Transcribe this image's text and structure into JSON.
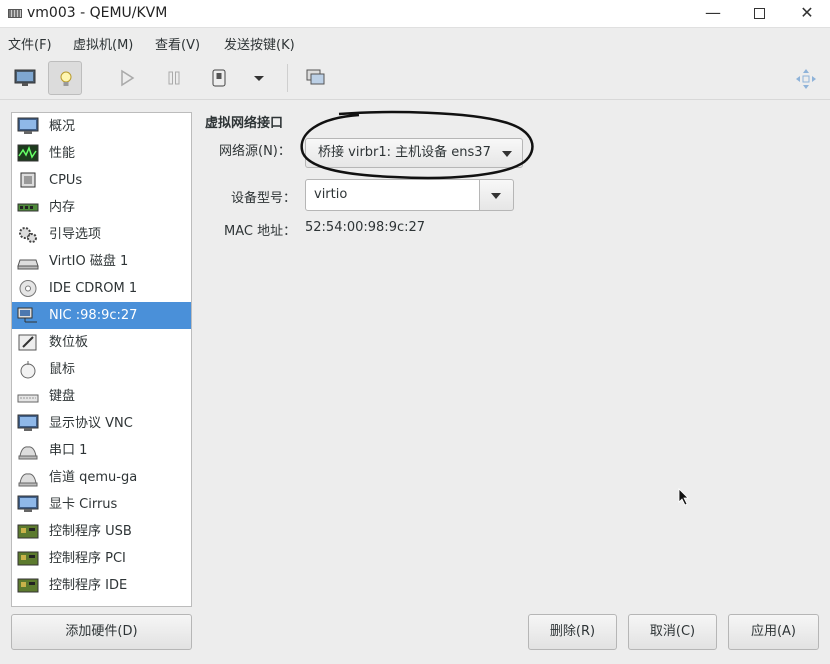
{
  "window": {
    "title": "vm003 - QEMU/KVM"
  },
  "menubar": {
    "items": [
      "文件(F)",
      "虚拟机(M)",
      "查看(V)",
      "发送按键(K)"
    ]
  },
  "toolbar": {
    "buttons": [
      {
        "icon": "monitor-icon",
        "active": false
      },
      {
        "icon": "lightbulb-icon",
        "active": true
      },
      {
        "icon": "play-icon",
        "active": false
      },
      {
        "icon": "pause-icon",
        "active": false
      },
      {
        "icon": "power-icon",
        "active": false
      },
      {
        "icon": "chevron-down-icon",
        "active": false
      },
      {
        "icon": "snapshots-icon",
        "active": false
      },
      {
        "icon": "fullscreen-icon",
        "active": false
      }
    ]
  },
  "sidebar": {
    "items": [
      {
        "label": "概况",
        "icon": "overview-monitor-icon"
      },
      {
        "label": "性能",
        "icon": "performance-icon"
      },
      {
        "label": "CPUs",
        "icon": "cpu-icon"
      },
      {
        "label": "内存",
        "icon": "memory-icon"
      },
      {
        "label": "引导选项",
        "icon": "boot-gear-icon"
      },
      {
        "label": "VirtIO 磁盘 1",
        "icon": "disk-icon"
      },
      {
        "label": "IDE CDROM 1",
        "icon": "cdrom-icon"
      },
      {
        "label": "NIC :98:9c:27",
        "icon": "nic-icon",
        "selected": true
      },
      {
        "label": "数位板",
        "icon": "tablet-icon"
      },
      {
        "label": "鼠标",
        "icon": "mouse-icon"
      },
      {
        "label": "键盘",
        "icon": "keyboard-icon"
      },
      {
        "label": "显示协议 VNC",
        "icon": "display-icon"
      },
      {
        "label": "串口 1",
        "icon": "serial-icon"
      },
      {
        "label": "信道 qemu-ga",
        "icon": "channel-icon"
      },
      {
        "label": "显卡 Cirrus",
        "icon": "video-icon"
      },
      {
        "label": "控制程序 USB",
        "icon": "controller-icon"
      },
      {
        "label": "控制程序 PCI",
        "icon": "controller-icon"
      },
      {
        "label": "控制程序 IDE",
        "icon": "controller-icon"
      }
    ]
  },
  "detail": {
    "section_title": "虚拟网络接口",
    "network_source_label": "网络源(N)：",
    "network_source_value": "桥接 virbr1: 主机设备 ens37",
    "device_model_label": "设备型号：",
    "device_model_value": "virtio",
    "mac_label": "MAC 地址：",
    "mac_value": "52:54:00:98:9c:27"
  },
  "buttons": {
    "add_hardware": "添加硬件(D)",
    "remove": "删除(R)",
    "cancel": "取消(C)",
    "apply": "应用(A)"
  },
  "colors": {
    "selection": "#4a90d9",
    "window_bg": "#ededed"
  }
}
